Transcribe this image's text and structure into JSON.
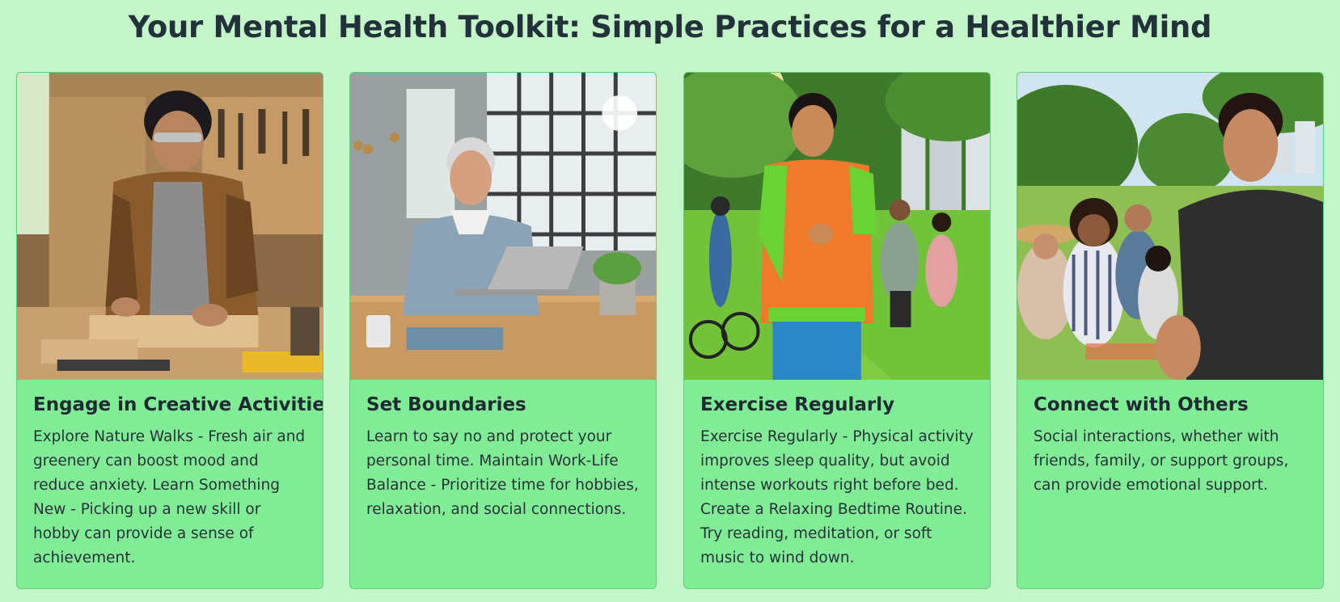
{
  "page": {
    "title": "Your Mental Health Toolkit: Simple Practices for a Healthier Mind"
  },
  "cards": [
    {
      "image_icon": "woodworking-photo",
      "title": "Engage in Creative Activities",
      "text": "Explore Nature Walks - Fresh air and greenery can boost mood and reduce anxiety. Learn Something New - Picking up a new skill or hobby can provide a sense of achievement."
    },
    {
      "image_icon": "office-desk-photo",
      "title": "Set Boundaries",
      "text": "Learn to say no and protect your personal time. Maintain Work-Life Balance - Prioritize time for hobbies, relaxation, and social connections."
    },
    {
      "image_icon": "park-running-photo",
      "title": "Exercise Regularly",
      "text": "Exercise Regularly - Physical activity improves sleep quality, but avoid intense workouts right before bed. Create a Relaxing Bedtime Routine. Try reading, meditation, or soft music to wind down."
    },
    {
      "image_icon": "friends-picnic-photo",
      "title": "Connect with Others",
      "text": "Social interactions, whether with friends, family, or support groups, can provide emotional support."
    }
  ],
  "colors": {
    "page_background": "#c3f5c9",
    "card_background": "#80ec95",
    "card_border": "#5fcf78",
    "text": "#1f2a33"
  }
}
